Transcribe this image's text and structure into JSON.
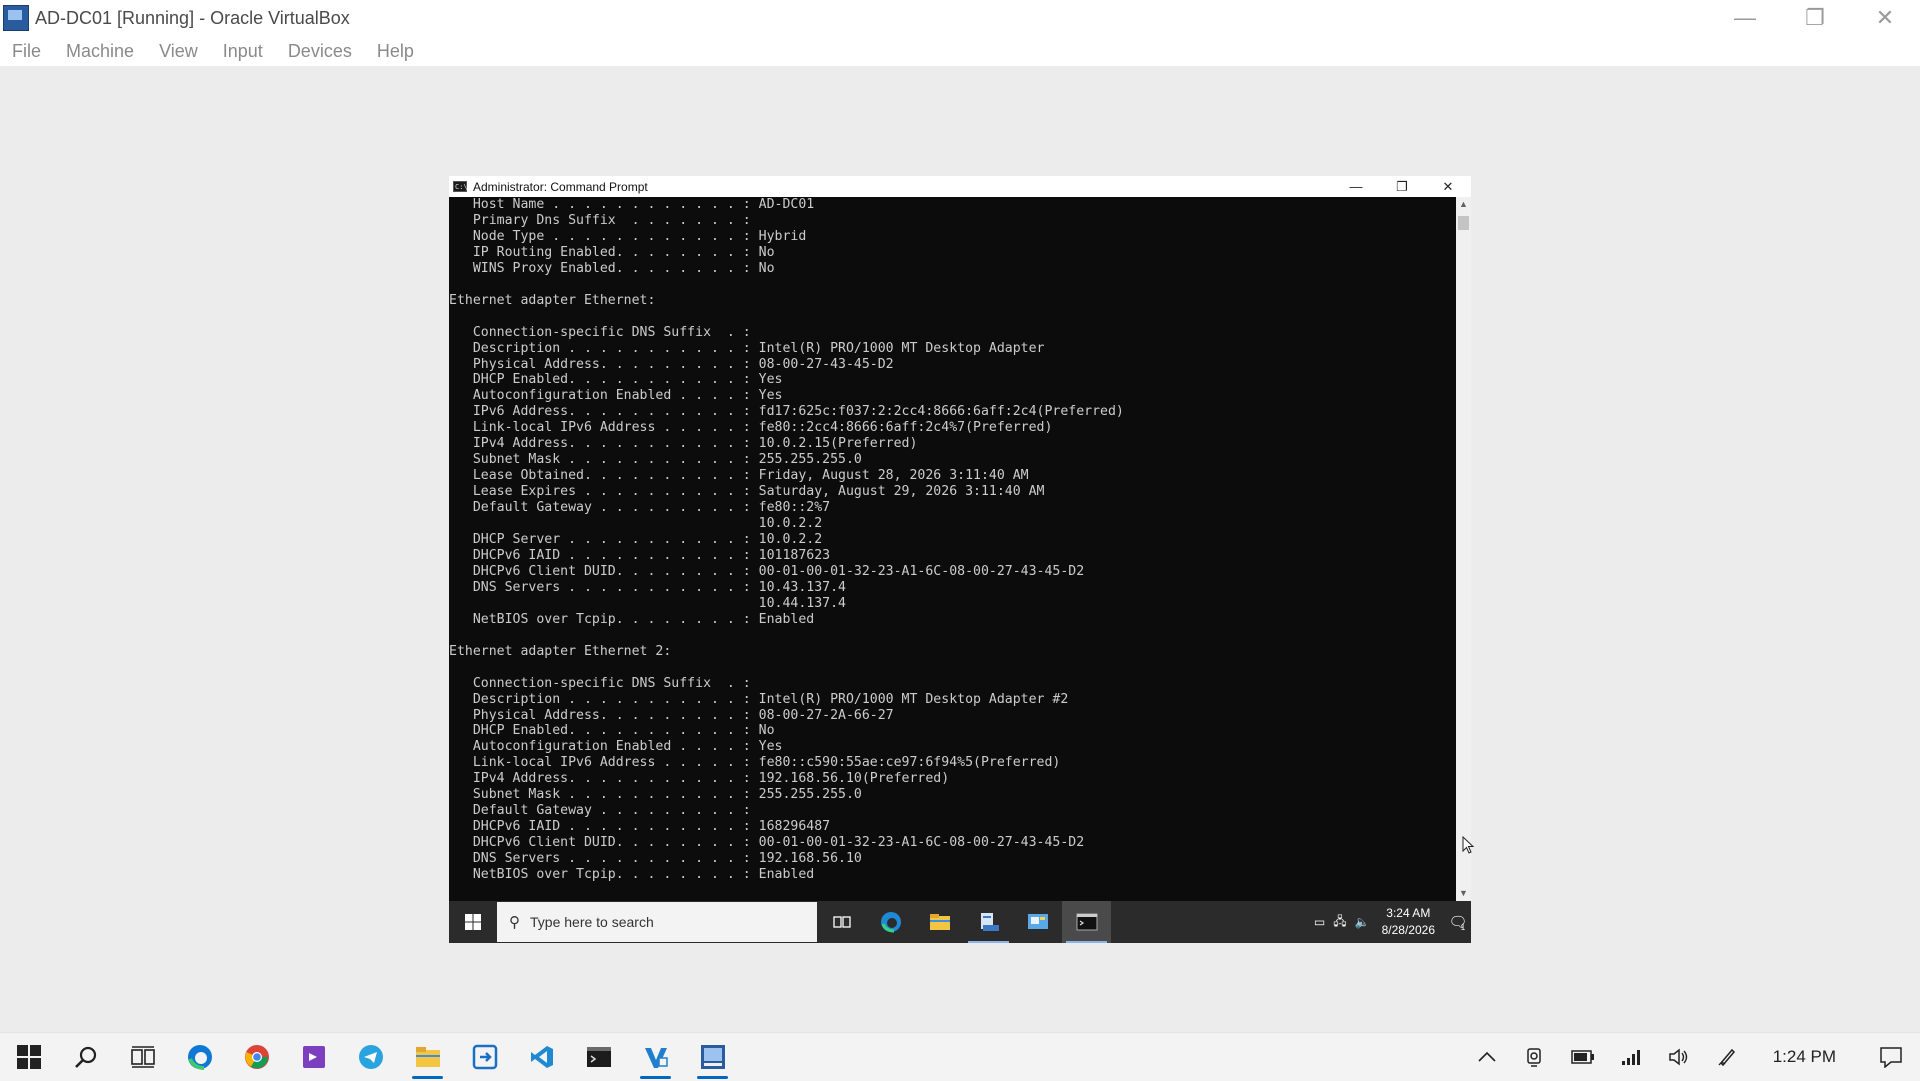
{
  "window": {
    "title": "AD-DC01 [Running] - Oracle VirtualBox",
    "controls": {
      "minimize": "—",
      "restore": "❐",
      "close": "✕"
    }
  },
  "menu": [
    "File",
    "Machine",
    "View",
    "Input",
    "Devices",
    "Help"
  ],
  "guest": {
    "cmd": {
      "title": "Administrator: Command Prompt",
      "icon_text": "C:\\",
      "controls": {
        "minimize": "—",
        "restore": "❐",
        "close": "✕"
      },
      "lines": [
        "   Host Name . . . . . . . . . . . . : AD-DC01",
        "   Primary Dns Suffix  . . . . . . . : ",
        "   Node Type . . . . . . . . . . . . : Hybrid",
        "   IP Routing Enabled. . . . . . . . : No",
        "   WINS Proxy Enabled. . . . . . . . : No",
        "",
        "Ethernet adapter Ethernet:",
        "",
        "   Connection-specific DNS Suffix  . : ",
        "   Description . . . . . . . . . . . : Intel(R) PRO/1000 MT Desktop Adapter",
        "   Physical Address. . . . . . . . . : 08-00-27-43-45-D2",
        "   DHCP Enabled. . . . . . . . . . . : Yes",
        "   Autoconfiguration Enabled . . . . : Yes",
        "   IPv6 Address. . . . . . . . . . . : fd17:625c:f037:2:2cc4:8666:6aff:2c4(Preferred)",
        "   Link-local IPv6 Address . . . . . : fe80::2cc4:8666:6aff:2c4%7(Preferred)",
        "   IPv4 Address. . . . . . . . . . . : 10.0.2.15(Preferred)",
        "   Subnet Mask . . . . . . . . . . . : 255.255.255.0",
        "   Lease Obtained. . . . . . . . . . : Friday, August 28, 2026 3:11:40 AM",
        "   Lease Expires . . . . . . . . . . : Saturday, August 29, 2026 3:11:40 AM",
        "   Default Gateway . . . . . . . . . : fe80::2%7",
        "                                       10.0.2.2",
        "   DHCP Server . . . . . . . . . . . : 10.0.2.2",
        "   DHCPv6 IAID . . . . . . . . . . . : 101187623",
        "   DHCPv6 Client DUID. . . . . . . . : 00-01-00-01-32-23-A1-6C-08-00-27-43-45-D2",
        "   DNS Servers . . . . . . . . . . . : 10.43.137.4",
        "                                       10.44.137.4",
        "   NetBIOS over Tcpip. . . . . . . . : Enabled",
        "",
        "Ethernet adapter Ethernet 2:",
        "",
        "   Connection-specific DNS Suffix  . : ",
        "   Description . . . . . . . . . . . : Intel(R) PRO/1000 MT Desktop Adapter #2",
        "   Physical Address. . . . . . . . . : 08-00-27-2A-66-27",
        "   DHCP Enabled. . . . . . . . . . . : No",
        "   Autoconfiguration Enabled . . . . : Yes",
        "   Link-local IPv6 Address . . . . . : fe80::c590:55ae:ce97:6f94%5(Preferred)",
        "   IPv4 Address. . . . . . . . . . . : 192.168.56.10(Preferred)",
        "   Subnet Mask . . . . . . . . . . . : 255.255.255.0",
        "   Default Gateway . . . . . . . . . : ",
        "   DHCPv6 IAID . . . . . . . . . . . : 168296487",
        "   DHCPv6 Client DUID. . . . . . . . : 00-01-00-01-32-23-A1-6C-08-00-27-43-45-D2",
        "   DNS Servers . . . . . . . . . . . : 192.168.56.10",
        "   NetBIOS over Tcpip. . . . . . . . : Enabled"
      ]
    },
    "taskbar": {
      "search_placeholder": "Type here to search",
      "apps": [
        "task-view-icon",
        "edge-icon",
        "file-explorer-icon",
        "server-manager-icon",
        "control-panel-icon",
        "command-prompt-icon"
      ],
      "clock_time": "3:24 AM",
      "clock_date": "8/28/2026",
      "notification_count": "1"
    }
  },
  "host_taskbar": {
    "apps": [
      "start-icon",
      "search-icon",
      "task-view-icon",
      "edge-icon",
      "chrome-icon",
      "visual-studio-icon",
      "telegram-icon",
      "file-explorer-icon",
      "remote-desktop-icon",
      "vscode-icon",
      "terminal-icon",
      "virtualbox-manager-icon",
      "virtualbox-vm-icon"
    ],
    "clock": "1:24 PM"
  },
  "colors": {
    "console_bg": "#0c0c0c",
    "console_fg": "#cccccc",
    "accent": "#0067c0"
  }
}
